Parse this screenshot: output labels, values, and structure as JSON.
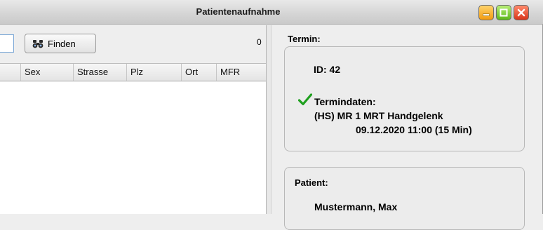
{
  "window": {
    "title": "Patientenaufnahme"
  },
  "left": {
    "search": {
      "value": "",
      "placeholder": ""
    },
    "find_button": {
      "label": "Finden",
      "icon": "binoculars-icon"
    },
    "result_count": "0",
    "table": {
      "columns": [
        "Sex",
        "Strasse",
        "Plz",
        "Ort",
        "MFR"
      ],
      "rows": []
    }
  },
  "right": {
    "termin": {
      "label": "Termin:",
      "id": "ID: 42",
      "dates_label": "Termindaten:",
      "dates_icon": "checkmark-icon",
      "exam": "(HS) MR 1 MRT Handgelenk",
      "datetime": "09.12.2020 11:00 (15 Min)"
    },
    "patient": {
      "label": "Patient:",
      "name": "Mustermann, Max"
    }
  },
  "colors": {
    "minimize": "#f29b12",
    "maximize": "#5cb71c",
    "close": "#d8351b",
    "check": "#1fa01f"
  }
}
